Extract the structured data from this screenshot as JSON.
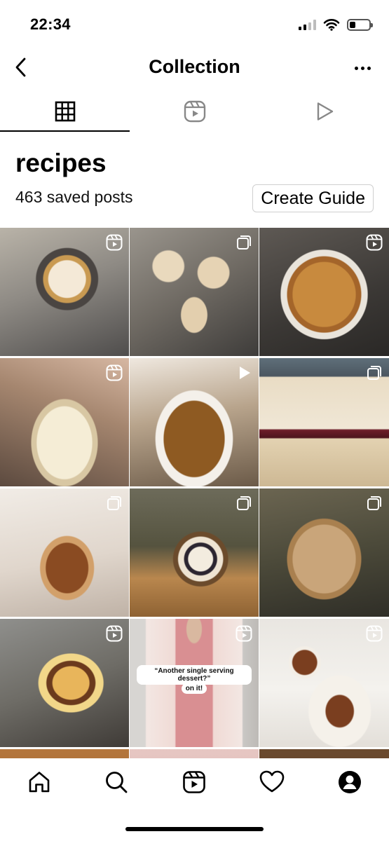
{
  "status": {
    "time": "22:34",
    "battery_level": 0.3
  },
  "header": {
    "title": "Collection",
    "back_icon": "chevron-left-icon",
    "more_icon": "more-horizontal-icon"
  },
  "tabs": [
    {
      "name": "grid",
      "icon": "grid-icon",
      "active": true
    },
    {
      "name": "reels",
      "icon": "reels-icon",
      "active": false
    },
    {
      "name": "videos",
      "icon": "play-icon",
      "active": false
    }
  ],
  "collection": {
    "name": "recipes",
    "count_text": "463 saved posts",
    "guide_button": "Create Guide"
  },
  "grid": {
    "tiles": [
      {
        "subject": "lemon meringue tart",
        "badge": "reels-icon"
      },
      {
        "subject": "iced scones",
        "badge": "carousel-icon"
      },
      {
        "subject": "pull-apart bread",
        "badge": "reels-icon"
      },
      {
        "subject": "piping cream onto tart",
        "badge": "reels-icon"
      },
      {
        "subject": "pumpkin pie",
        "badge": "play-icon"
      },
      {
        "subject": "cherry sheet cake",
        "badge": "carousel-icon"
      },
      {
        "subject": "muffin with glaze",
        "badge": "carousel-icon"
      },
      {
        "subject": "layered walnut cake",
        "badge": "carousel-icon"
      },
      {
        "subject": "walnut cake",
        "badge": "carousel-icon"
      },
      {
        "subject": "cheesecake stack",
        "badge": "reels-icon"
      },
      {
        "subject": "reel with caption",
        "badge": "reels-icon",
        "text_1": "“Another single serving dessert?”",
        "text_2": "on it!"
      },
      {
        "subject": "cake slices on plates",
        "badge": "reels-icon"
      }
    ]
  },
  "bottom_nav": [
    {
      "name": "home",
      "icon": "home-icon"
    },
    {
      "name": "search",
      "icon": "search-icon"
    },
    {
      "name": "reels",
      "icon": "reels-icon"
    },
    {
      "name": "activity",
      "icon": "heart-icon"
    },
    {
      "name": "profile",
      "icon": "profile-icon"
    }
  ],
  "colors": {
    "text": "#000000",
    "border": "#cfcfcf",
    "background": "#ffffff"
  }
}
